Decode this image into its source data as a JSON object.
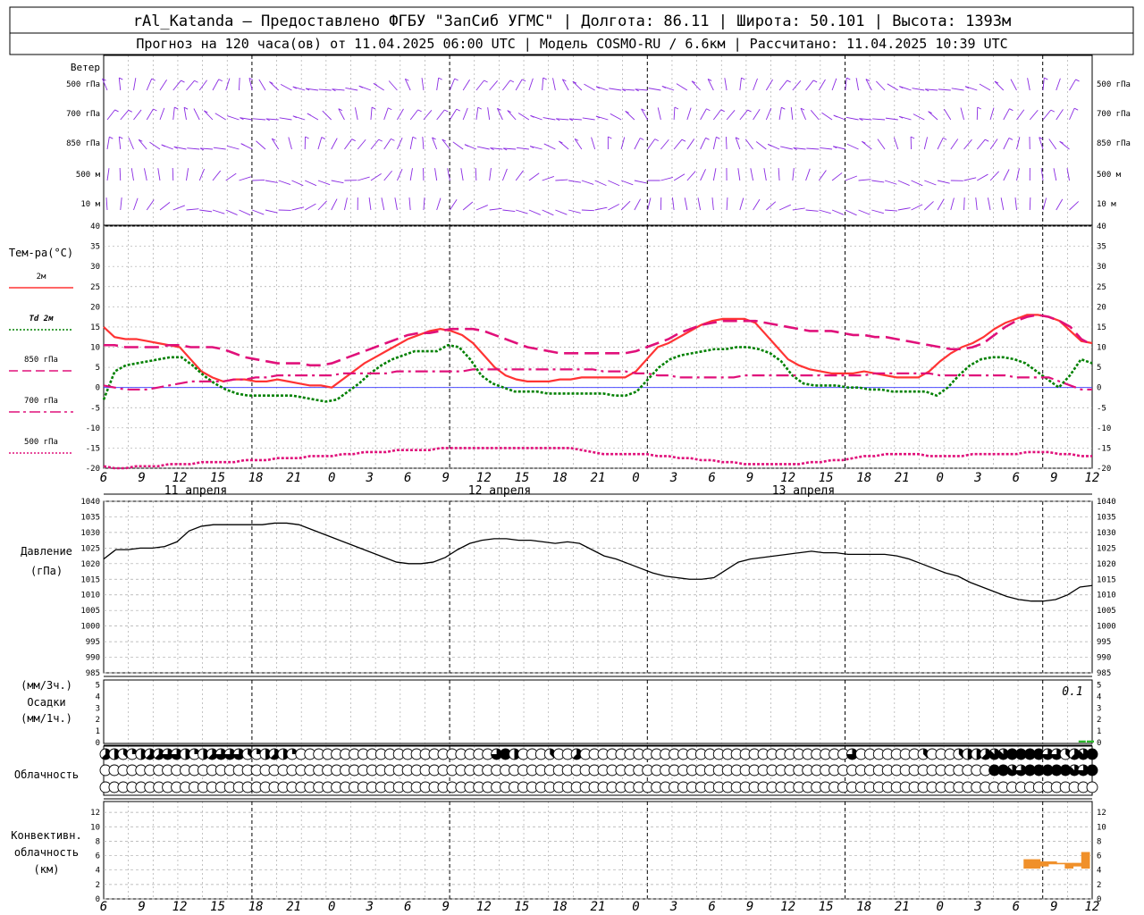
{
  "header": {
    "line1": "rAl_Katanda – Предоставлено ФГБУ \"ЗапСиб УГМС\" | Долгота: 86.11 | Широта: 50.101 | Высота: 1393м",
    "line2": "Прогноз на 120 часа(ов) от 11.04.2025 06:00 UTC  | Модель COSMO-RU / 6.6км | Рассчитано: 11.04.2025 10:39 UTC"
  },
  "wind_panel": {
    "label": "Ветер",
    "levels": [
      "500 гПа",
      "700 гПа",
      "850 гПа",
      "500 м",
      "10  м"
    ],
    "right_levels": [
      "500 гПа",
      "700 гПа",
      "850 гПа",
      "500 м",
      "10  м"
    ],
    "barb_color": "#8a2be2"
  },
  "time_axis": {
    "hour_labels": [
      "6",
      "9",
      "12",
      "15",
      "18",
      "21",
      "0",
      "3",
      "6",
      "9",
      "12",
      "15",
      "18",
      "21",
      "0",
      "3",
      "6",
      "9",
      "12",
      "15",
      "18",
      "21",
      "0",
      "3",
      "6",
      "9",
      "12"
    ],
    "day_labels": [
      "11 апреля",
      "12 апреля",
      "13 апреля"
    ]
  },
  "temperature_panel": {
    "title": "Тем-ра(°C)",
    "legend": [
      {
        "label": "2м",
        "color": "#ff3333",
        "style": "solid"
      },
      {
        "label": "Td  2м",
        "color": "#008000",
        "style": "dotted"
      },
      {
        "label": "850 гПа",
        "color": "#e0107a",
        "style": "dashed"
      },
      {
        "label": "700 гПа",
        "color": "#e0107a",
        "style": "dashdot"
      },
      {
        "label": "500 гПа",
        "color": "#e0107a",
        "style": "dotted"
      }
    ],
    "ylim": [
      -20,
      40
    ],
    "ticks": [
      40,
      35,
      30,
      25,
      20,
      15,
      10,
      5,
      0,
      -5,
      -10,
      -15,
      -20
    ]
  },
  "pressure_panel": {
    "title1": "Давление",
    "title2": "(гПа)",
    "ylim": [
      985,
      1040
    ],
    "ticks": [
      1040,
      1035,
      1030,
      1025,
      1020,
      1015,
      1010,
      1005,
      1000,
      995,
      990,
      985
    ]
  },
  "precip_panel": {
    "title1": "(мм/3ч.)",
    "title2": "Осадки",
    "title3": "(мм/1ч.)",
    "ticks": [
      5,
      4,
      3,
      2,
      1,
      0
    ],
    "annotation": "0.1"
  },
  "cloud_panel": {
    "title": "Облачность"
  },
  "convective_panel": {
    "title1": "Конвективн.",
    "title2": "облачность",
    "title3": "(км)",
    "ticks": [
      12,
      10,
      8,
      6,
      4,
      2,
      0
    ],
    "bar_color": "#f0902a"
  },
  "chart_data": [
    {
      "type": "line",
      "name": "temperature",
      "x_unit": "hours from 11.04.2025 06:00 UTC",
      "x": [
        0,
        1,
        2,
        3,
        4,
        5,
        6,
        7,
        8,
        9,
        10,
        11,
        12,
        13,
        14,
        15,
        16,
        17,
        18,
        19,
        20,
        21,
        22,
        23,
        24,
        25,
        26,
        27,
        28,
        29,
        30,
        31,
        32,
        33,
        34,
        35,
        36,
        37,
        38,
        39,
        40,
        41,
        42,
        43,
        44,
        45,
        46,
        47,
        48,
        49,
        50,
        51,
        52,
        53,
        54,
        55,
        56,
        57,
        58,
        59,
        60,
        61,
        62,
        63,
        64,
        65,
        66,
        67,
        68,
        69,
        70,
        71,
        72,
        73,
        74,
        75,
        76,
        77,
        78,
        79,
        80,
        81,
        82,
        83,
        84,
        85,
        86,
        87,
        88,
        89,
        90,
        91,
        92,
        93,
        94,
        95,
        96,
        97,
        98,
        99,
        100,
        101,
        102,
        103,
        104,
        105,
        106,
        107,
        108,
        109,
        110,
        111,
        112,
        113,
        114,
        115,
        116,
        117,
        118,
        119,
        120
      ],
      "series": [
        {
          "name": "2м",
          "color": "#ff3333",
          "style": "solid",
          "values": [
            15,
            12.5,
            12,
            12,
            11.5,
            11,
            10.5,
            10,
            7,
            4,
            2.5,
            1.5,
            2,
            2,
            1.5,
            1.5,
            2,
            1.5,
            1,
            0.5,
            0.5,
            0,
            2,
            4,
            6,
            7.5,
            9,
            10.5,
            12,
            13,
            14,
            14.5,
            14,
            13,
            11,
            8,
            5,
            3,
            2,
            1.5,
            1.5,
            1.5,
            2,
            2,
            2.5,
            2.5,
            2.5,
            2.5,
            2.5,
            4,
            7,
            10,
            11,
            12.5,
            14,
            15.5,
            16.5,
            17,
            17,
            17,
            16,
            13,
            10,
            7,
            5.5,
            4.5,
            4,
            3.5,
            3.5,
            3.5,
            4,
            3.5,
            3,
            2.5,
            2.5,
            2.5,
            4,
            6.5,
            8.5,
            10,
            11,
            12.5,
            14.5,
            16,
            17,
            18,
            18,
            17.5,
            16.5,
            14,
            11.5,
            11
          ]
        },
        {
          "name": "Td  2м",
          "color": "#008000",
          "style": "dotted",
          "values": [
            -3,
            4,
            5.5,
            6,
            6.5,
            7,
            7.5,
            7.5,
            5.5,
            3,
            1,
            -0.5,
            -1.5,
            -2,
            -2,
            -2,
            -2,
            -2,
            -2.5,
            -3,
            -3.5,
            -3,
            -1,
            1,
            3.5,
            5.5,
            7,
            8,
            9,
            9,
            9,
            10.5,
            10,
            7,
            3,
            1,
            0,
            -1,
            -1,
            -1,
            -1.5,
            -1.5,
            -1.5,
            -1.5,
            -1.5,
            -1.5,
            -2,
            -2,
            -1,
            2,
            5,
            7,
            8,
            8.5,
            9,
            9.5,
            9.5,
            10,
            10,
            9.5,
            8.5,
            6.5,
            3,
            1,
            0.5,
            0.5,
            0.5,
            0,
            0,
            -0.5,
            -0.5,
            -1,
            -1,
            -1,
            -1,
            -2,
            0,
            3,
            5.5,
            7,
            7.5,
            7.5,
            7,
            6,
            4,
            2,
            0,
            3,
            7,
            6
          ]
        },
        {
          "name": "850 гПа",
          "color": "#e0107a",
          "style": "dashed",
          "values": [
            10.5,
            10.5,
            10,
            10,
            10,
            10,
            10.5,
            10.5,
            10,
            10,
            10,
            9.5,
            8.5,
            7.5,
            7,
            6.5,
            6,
            6,
            6,
            5.5,
            5.5,
            6,
            7,
            8,
            9,
            10,
            11,
            12,
            13,
            13.5,
            13.5,
            14,
            14.5,
            14.5,
            14.5,
            14,
            13,
            12,
            11,
            10,
            9.5,
            9,
            8.5,
            8.5,
            8.5,
            8.5,
            8.5,
            8.5,
            8.5,
            9,
            10,
            11,
            12,
            13.5,
            14.5,
            15.5,
            16,
            16.5,
            16.5,
            16.5,
            16.5,
            16,
            15.5,
            15,
            14.5,
            14,
            14,
            14,
            13.5,
            13,
            13,
            12.5,
            12.5,
            12,
            11.5,
            11,
            10.5,
            10,
            9.5,
            9.5,
            10,
            11,
            13,
            15,
            16.5,
            17.5,
            18,
            17.5,
            16.5,
            15,
            12,
            10.5
          ]
        },
        {
          "name": "700 гПа",
          "color": "#e0107a",
          "style": "dashdot",
          "values": [
            0.5,
            0,
            -0.5,
            -0.5,
            -0.5,
            0,
            0.5,
            1,
            1.5,
            1.5,
            1.5,
            1.5,
            2,
            2,
            2.5,
            2.5,
            3,
            3,
            3,
            3,
            3,
            3,
            3.5,
            3.5,
            3.5,
            3.5,
            3.5,
            4,
            4,
            4,
            4,
            4,
            4,
            4,
            4.5,
            4.5,
            4.5,
            4.5,
            4.5,
            4.5,
            4.5,
            4.5,
            4.5,
            4.5,
            4.5,
            4.5,
            4,
            4,
            4,
            3.5,
            3.5,
            3,
            3,
            2.5,
            2.5,
            2.5,
            2.5,
            2.5,
            2.5,
            3,
            3,
            3,
            3,
            3,
            3,
            3,
            3,
            3,
            3,
            3,
            3,
            3.5,
            3.5,
            3.5,
            3.5,
            3.5,
            3.5,
            3,
            3,
            3,
            3,
            3,
            3,
            3,
            2.5,
            2.5,
            2.5,
            2.5,
            1.5,
            0.5,
            -0.5,
            -0.5
          ]
        },
        {
          "name": "500 гПа",
          "color": "#e0107a",
          "style": "dotted",
          "values": [
            -19.5,
            -20,
            -20,
            -19.5,
            -19.5,
            -19.5,
            -19,
            -19,
            -19,
            -18.5,
            -18.5,
            -18.5,
            -18.5,
            -18,
            -18,
            -18,
            -17.5,
            -17.5,
            -17.5,
            -17,
            -17,
            -17,
            -16.5,
            -16.5,
            -16,
            -16,
            -16,
            -15.5,
            -15.5,
            -15.5,
            -15.5,
            -15,
            -15,
            -15,
            -15,
            -15,
            -15,
            -15,
            -15,
            -15,
            -15,
            -15,
            -15,
            -15,
            -15.5,
            -16,
            -16.5,
            -16.5,
            -16.5,
            -16.5,
            -16.5,
            -17,
            -17,
            -17.5,
            -17.5,
            -18,
            -18,
            -18.5,
            -18.5,
            -19,
            -19,
            -19,
            -19,
            -19,
            -19,
            -18.5,
            -18.5,
            -18,
            -18,
            -17.5,
            -17,
            -17,
            -16.5,
            -16.5,
            -16.5,
            -16.5,
            -17,
            -17,
            -17,
            -17,
            -16.5,
            -16.5,
            -16.5,
            -16.5,
            -16.5,
            -16,
            -16,
            -16,
            -16.5,
            -16.5,
            -17,
            -17
          ]
        }
      ]
    },
    {
      "type": "line",
      "name": "pressure",
      "x_unit": "hours from 11.04.2025 06:00 UTC",
      "series": [
        {
          "name": "Давление",
          "color": "#000000",
          "values": [
            1021.5,
            1024.5,
            1024.5,
            1025,
            1025,
            1025.5,
            1027,
            1030.5,
            1032,
            1032.5,
            1032.5,
            1032.5,
            1032.5,
            1032.5,
            1033,
            1033,
            1032.5,
            1031,
            1029.5,
            1028,
            1026.5,
            1025,
            1023.5,
            1022,
            1020.5,
            1020,
            1020,
            1020.5,
            1022,
            1024.5,
            1026.5,
            1027.5,
            1028,
            1028,
            1027.5,
            1027.5,
            1027,
            1026.5,
            1027,
            1026.5,
            1024.5,
            1022.5,
            1021.5,
            1020,
            1018.5,
            1017,
            1016,
            1015.5,
            1015,
            1015,
            1015.5,
            1018,
            1020.5,
            1021.5,
            1022,
            1022.5,
            1023,
            1023.5,
            1024,
            1023.5,
            1023.5,
            1023,
            1023,
            1023,
            1023,
            1022.5,
            1021.5,
            1020,
            1018.5,
            1017,
            1016,
            1014,
            1012.5,
            1011,
            1009.5,
            1008.5,
            1008,
            1008,
            1008.5,
            1010,
            1012.5,
            1013
          ]
        }
      ],
      "ylim": [
        985,
        1040
      ]
    },
    {
      "type": "bar",
      "name": "convective_cloud_top_km",
      "categories_hours": [
        112,
        113,
        114,
        115,
        116,
        117,
        118,
        119
      ],
      "values": [
        5.5,
        5.5,
        5.2,
        5.2,
        5,
        5,
        5,
        6.5
      ],
      "bottom_values": [
        4.2,
        4.2,
        4.5,
        4.8,
        4.8,
        4.2,
        4.5,
        4.2
      ]
    },
    {
      "type": "bar",
      "name": "precipitation_mm",
      "categories_hours": [
        118,
        119,
        120
      ],
      "values": [
        0,
        0.1,
        0.1
      ]
    }
  ],
  "cloud_rows": {
    "upper": [
      5,
      4,
      3,
      2,
      4,
      5,
      5,
      6,
      6,
      4,
      2,
      4,
      5,
      6,
      6,
      6,
      3,
      2,
      4,
      5,
      4,
      2,
      0,
      0,
      0,
      0,
      0,
      0,
      0,
      0,
      0,
      0,
      0,
      0,
      0,
      0,
      0,
      0,
      0,
      0,
      0,
      0,
      0,
      0,
      6,
      8,
      4,
      0,
      0,
      0,
      3,
      0,
      0,
      5,
      0,
      0,
      0,
      0,
      0,
      0,
      0,
      0,
      0,
      0,
      0,
      0,
      0,
      0,
      0,
      0,
      0,
      0,
      0,
      0,
      0,
      0,
      0,
      0,
      0,
      0,
      0,
      0,
      0,
      0,
      6,
      0,
      0,
      0,
      0,
      0,
      0,
      0,
      3,
      0,
      0,
      0,
      3,
      4,
      4,
      5,
      7,
      7,
      8,
      8,
      8,
      8,
      6,
      6,
      3,
      5,
      7,
      8
    ],
    "middle": [
      0,
      0,
      0,
      0,
      0,
      0,
      0,
      0,
      0,
      0,
      0,
      0,
      0,
      0,
      0,
      0,
      0,
      0,
      0,
      0,
      0,
      0,
      0,
      0,
      0,
      0,
      0,
      0,
      0,
      0,
      0,
      0,
      0,
      0,
      0,
      0,
      0,
      0,
      0,
      0,
      0,
      0,
      0,
      0,
      0,
      0,
      0,
      0,
      0,
      0,
      0,
      0,
      0,
      0,
      0,
      0,
      0,
      0,
      0,
      0,
      0,
      0,
      0,
      0,
      0,
      0,
      0,
      0,
      0,
      0,
      0,
      0,
      0,
      0,
      0,
      0,
      0,
      0,
      0,
      0,
      0,
      0,
      0,
      0,
      0,
      0,
      0,
      0,
      0,
      0,
      0,
      0,
      0,
      0,
      0,
      0,
      0,
      0,
      0,
      0,
      8,
      8,
      7,
      6,
      8,
      8,
      8,
      8,
      8,
      7,
      6,
      8
    ],
    "lower": [
      0,
      0,
      0,
      0,
      0,
      0,
      0,
      0,
      0,
      0,
      0,
      0,
      0,
      0,
      0,
      0,
      0,
      0,
      0,
      0,
      0,
      0,
      0,
      0,
      0,
      0,
      0,
      0,
      0,
      0,
      0,
      0,
      0,
      0,
      0,
      0,
      0,
      0,
      0,
      0,
      0,
      0,
      0,
      0,
      0,
      0,
      0,
      0,
      0,
      0,
      0,
      0,
      0,
      0,
      0,
      0,
      0,
      0,
      0,
      0,
      0,
      0,
      0,
      0,
      0,
      0,
      0,
      0,
      0,
      0,
      0,
      0,
      0,
      0,
      0,
      0,
      0,
      0,
      0,
      0,
      0,
      0,
      0,
      0,
      0,
      0,
      0,
      0,
      0,
      0,
      0,
      0,
      0,
      0,
      0,
      0,
      0,
      0,
      0,
      0,
      0,
      0,
      0,
      0,
      0,
      0,
      0,
      0,
      0,
      0,
      0,
      0
    ]
  }
}
